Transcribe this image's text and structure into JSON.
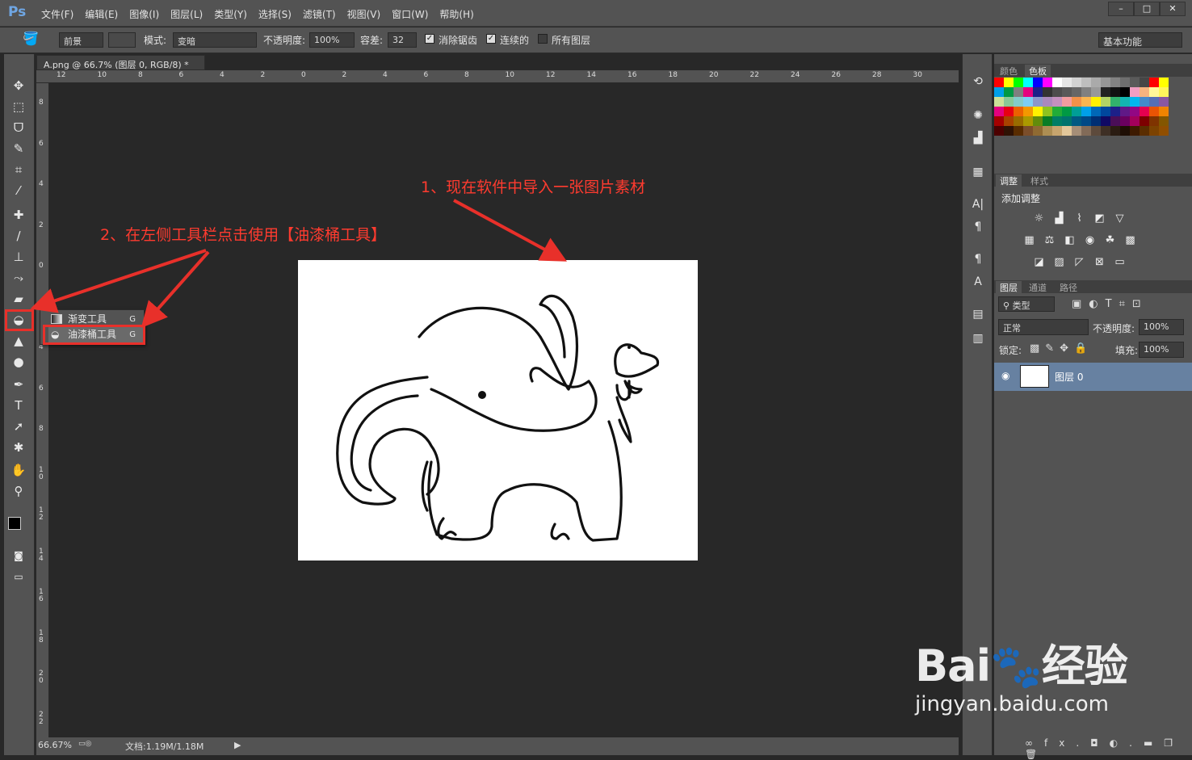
{
  "app": {
    "logo": "Ps"
  },
  "menu": [
    "文件(F)",
    "编辑(E)",
    "图像(I)",
    "图层(L)",
    "类型(Y)",
    "选择(S)",
    "滤镜(T)",
    "视图(V)",
    "窗口(W)",
    "帮助(H)"
  ],
  "window_buttons": [
    "–",
    "□",
    "✕"
  ],
  "options": {
    "fill_source": "前景",
    "mode_label": "模式:",
    "mode_value": "变暗",
    "opacity_label": "不透明度:",
    "opacity_value": "100%",
    "tolerance_label": "容差:",
    "tolerance_value": "32",
    "antialias_label": "消除锯齿",
    "contiguous_label": "连续的",
    "all_layers_label": "所有图层",
    "workspace": "基本功能"
  },
  "document": {
    "tab_title": "A.png @ 66.7% (图层 0, RGB/8) *",
    "close": "×"
  },
  "ruler_top": [
    "12",
    "10",
    "8",
    "6",
    "4",
    "2",
    "0",
    "2",
    "4",
    "6",
    "8",
    "10",
    "12",
    "14",
    "16",
    "18",
    "20",
    "22",
    "24",
    "26",
    "28",
    "30"
  ],
  "ruler_left": [
    "8",
    "6",
    "4",
    "2",
    "0",
    "2",
    "4",
    "6",
    "8",
    "1 0",
    "1 2",
    "1 4",
    "1 6",
    "1 8",
    "2 0",
    "2 2"
  ],
  "status": {
    "zoom": "66.67%",
    "doc": "文档:1.19M/1.18M"
  },
  "annotations": {
    "step1": "1、现在软件中导入一张图片素材",
    "step2": "2、在左侧工具栏点击使用【油漆桶工具】"
  },
  "flyout": [
    {
      "label": "渐变工具",
      "key": "G"
    },
    {
      "label": "油漆桶工具",
      "key": "G"
    }
  ],
  "panels": {
    "color_tabs": [
      "颜色",
      "色板"
    ],
    "adjust_tabs": [
      "调整",
      "样式"
    ],
    "adjust_title": "添加调整",
    "layer_tabs": [
      "图层",
      "通道",
      "路径"
    ],
    "layer_filter": "类型",
    "blend_mode": "正常",
    "opacity_label": "不透明度:",
    "opacity_value": "100%",
    "lock_label": "锁定:",
    "fill_label": "填充:",
    "fill_value": "100%",
    "layer_name": "图层 0",
    "bottom_icons": [
      "∞",
      "fx.",
      "◘",
      "◐.",
      "▬",
      "❐",
      "🗑"
    ]
  },
  "watermark": {
    "brand": "Bai",
    "brand2": "经验",
    "url": "jingyan.baidu.com"
  },
  "swatches": [
    "#ff0000",
    "#ffff00",
    "#00ff00",
    "#00ffff",
    "#0000ff",
    "#ff00ff",
    "#ffffff",
    "#e6e6e6",
    "#d2d2d2",
    "#bebebe",
    "#aaaaaa",
    "#969696",
    "#828282",
    "#6e6e6e",
    "#5a5a5a",
    "#464646",
    "#ff0000",
    "#ffff00",
    "#00a0e9",
    "#009944",
    "#7f7f7f",
    "#e5007f",
    "#1d2088",
    "#333333",
    "#4d4d4d",
    "#595959",
    "#666666",
    "#808080",
    "#999999",
    "#222222",
    "#111111",
    "#000000",
    "#f19ec2",
    "#f6b37f",
    "#fff799",
    "#fff45c",
    "#cce198",
    "#89c997",
    "#84ccc9",
    "#7ecef4",
    "#8c97cb",
    "#aa89bd",
    "#c490bf",
    "#f29c9f",
    "#f19149",
    "#f8b551",
    "#fff100",
    "#b3d465",
    "#32b16c",
    "#13b5b1",
    "#00b7ee",
    "#448aca",
    "#556fb5",
    "#8957a1",
    "#e4007f",
    "#e60012",
    "#eb6100",
    "#f39800",
    "#fff100",
    "#8fc31f",
    "#22ac38",
    "#009944",
    "#009e96",
    "#00a0e9",
    "#0068b7",
    "#00479d",
    "#1d2088",
    "#601986",
    "#920783",
    "#e5004f",
    "#ea5404",
    "#f08300",
    "#a40000",
    "#a84200",
    "#996c00",
    "#ab9a00",
    "#638c0b",
    "#097c25",
    "#007d65",
    "#00736d",
    "#005982",
    "#004986",
    "#002e73",
    "#100964",
    "#4a0e58",
    "#6a005f",
    "#a3005b",
    "#7d0000",
    "#7f3300",
    "#835600",
    "#4c0000",
    "#2f1204",
    "#592c00",
    "#7b4e2a",
    "#8f6a32",
    "#ad8e53",
    "#c7a56e",
    "#e2c79a",
    "#a58e77",
    "#826b58",
    "#5d4a3c",
    "#3e2f25",
    "#2a1c12",
    "#1e0e04",
    "#3d1a00",
    "#5a2d00",
    "#7c4200",
    "#904e00"
  ]
}
